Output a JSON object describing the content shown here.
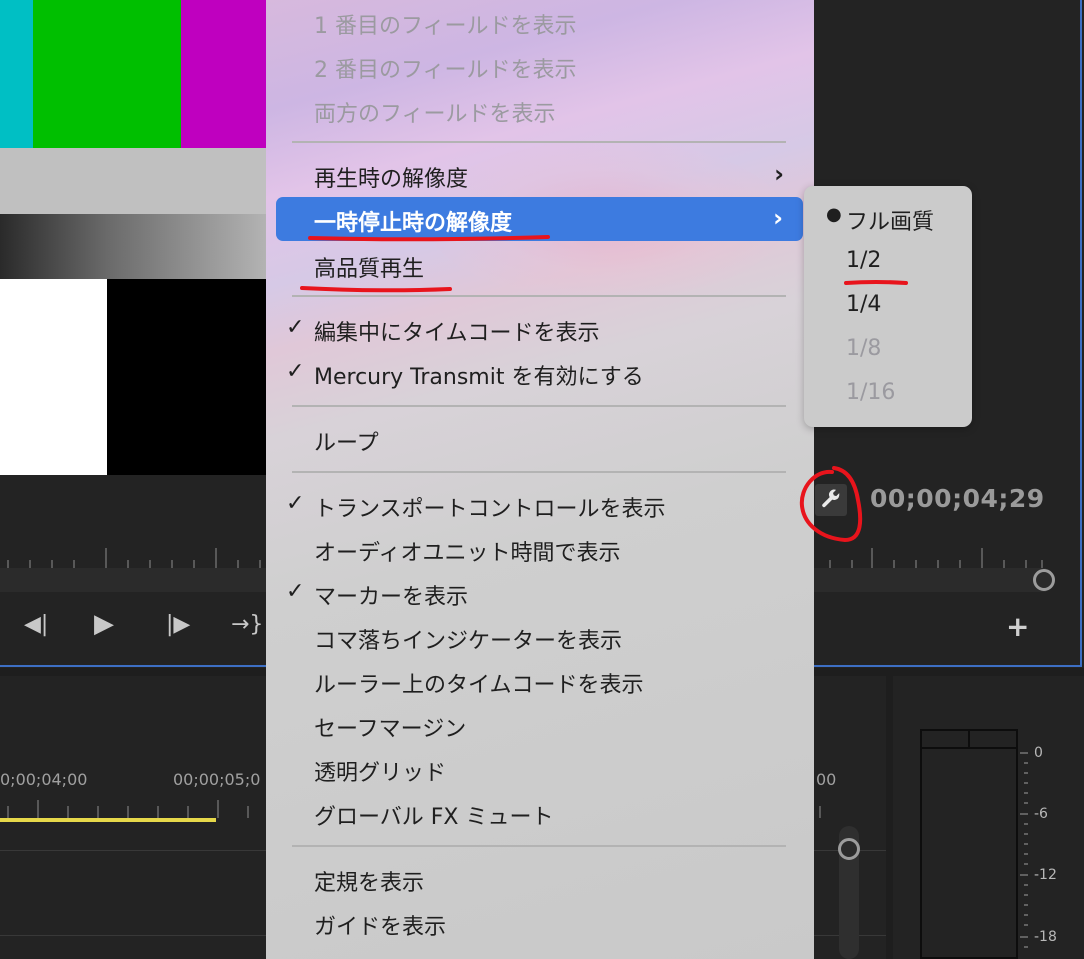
{
  "monitor": {
    "timecode": "00;00;04;29",
    "settings_icon": "wrench-icon",
    "controls": [
      {
        "icon": "step-back-icon",
        "glyph": "◀|"
      },
      {
        "icon": "play-icon",
        "glyph": "▶"
      },
      {
        "icon": "step-forward-icon",
        "glyph": "|▶"
      },
      {
        "icon": "go-to-out-icon",
        "glyph": "→}"
      }
    ],
    "add_button_icon": "plus-icon"
  },
  "timeline": {
    "time_labels": [
      "0;00;04;00",
      "00;00;05;0",
      "00"
    ]
  },
  "meter": {
    "db_labels": [
      "0",
      "-6",
      "-12",
      "-18"
    ]
  },
  "menu": {
    "items": [
      {
        "label": "1 番目のフィールドを表示",
        "checked": false,
        "disabled": true
      },
      {
        "label": "2 番目のフィールドを表示",
        "checked": false,
        "disabled": true
      },
      {
        "label": "両方のフィールドを表示",
        "checked": false,
        "disabled": true
      },
      {
        "label": "再生時の解像度",
        "submenu": true
      },
      {
        "label": "一時停止時の解像度",
        "submenu": true,
        "highlighted": true
      },
      {
        "label": "高品質再生"
      },
      {
        "label": "編集中にタイムコードを表示",
        "checked": true
      },
      {
        "label": "Mercury Transmit を有効にする",
        "checked": true
      },
      {
        "label": "ループ"
      },
      {
        "label": "トランスポートコントロールを表示",
        "checked": true
      },
      {
        "label": "オーディオユニット時間で表示"
      },
      {
        "label": "マーカーを表示",
        "checked": true
      },
      {
        "label": "コマ落ちインジケーターを表示"
      },
      {
        "label": "ルーラー上のタイムコードを表示"
      },
      {
        "label": "セーフマージン"
      },
      {
        "label": "透明グリッド"
      },
      {
        "label": "グローバル FX ミュート"
      },
      {
        "label": "定規を表示"
      },
      {
        "label": "ガイドを表示"
      }
    ],
    "check_glyph": "✓",
    "arrow_glyph": "›"
  },
  "submenu": {
    "items": [
      {
        "label": "フル画質",
        "selected": true
      },
      {
        "label": "1/2"
      },
      {
        "label": "1/4"
      },
      {
        "label": "1/8",
        "disabled": true
      },
      {
        "label": "1/16",
        "disabled": true
      }
    ],
    "bullet_glyph": "●"
  },
  "colors": {
    "highlight": "#3d7be0",
    "annotation": "#e8141c",
    "panel_border": "#3d6fc4"
  }
}
